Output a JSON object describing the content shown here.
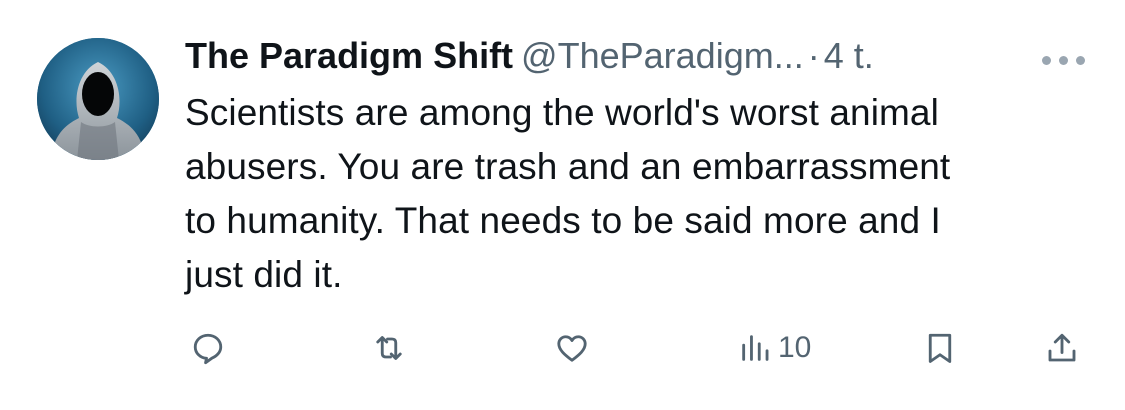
{
  "tweet": {
    "author_name": "The Paradigm Shift",
    "handle": "@TheParadigm...",
    "separator": "·",
    "time": "4 t.",
    "text": "Scientists are among the world's worst animal\nabusers. You are trash and an embarrassment\nto humanity. That needs to be said more and I\njust did it."
  },
  "actions": {
    "views_count": "10"
  },
  "icons": {
    "avatar": "hooded-figure-avatar",
    "more": "more-dots-icon",
    "reply": "reply-icon",
    "retweet": "retweet-icon",
    "like": "heart-icon",
    "views": "views-icon",
    "bookmark": "bookmark-icon",
    "share": "share-icon"
  },
  "colors": {
    "text": "#0f1419",
    "secondary": "#536471",
    "avatar_bg": "#2b6f93"
  }
}
